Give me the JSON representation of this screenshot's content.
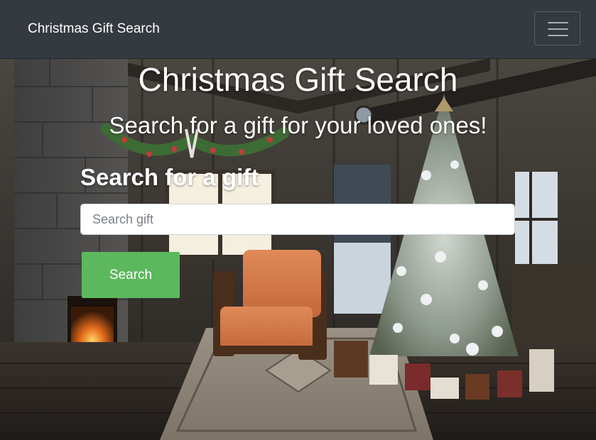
{
  "navbar": {
    "brand": "Christmas Gift Search",
    "toggler_icon": "hamburger-menu-icon",
    "background_color": "#343a40"
  },
  "hero": {
    "title": "Christmas Gift Search",
    "subtitle": "Search for a gift for your loved ones!"
  },
  "search": {
    "heading": "Search for a gift",
    "input_value": "",
    "placeholder": "Search gift",
    "button_label": "Search",
    "button_color": "#5cb85c"
  }
}
